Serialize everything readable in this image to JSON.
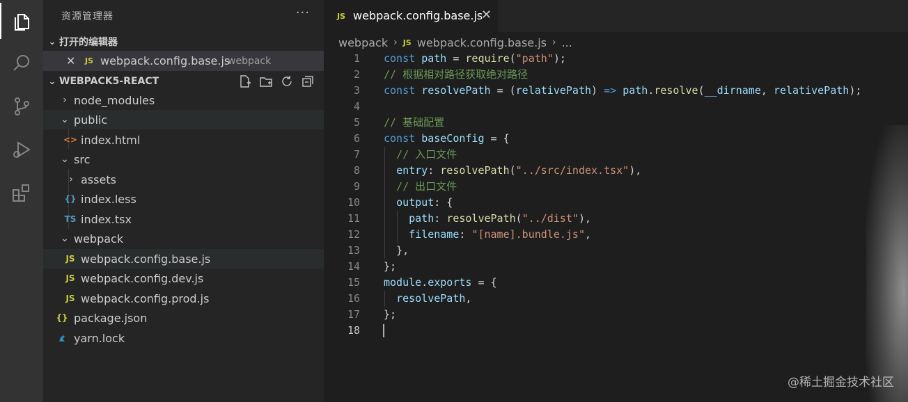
{
  "activity_bar": {
    "icons": [
      "explorer-icon",
      "search-icon",
      "source-control-icon",
      "run-debug-icon",
      "extensions-icon"
    ]
  },
  "sidebar": {
    "title": "资源管理器",
    "more": "···",
    "open_editors": {
      "header": "打开的编辑器",
      "items": [
        {
          "badge": "JS",
          "name": "webpack.config.base.js",
          "desc": "webpack"
        }
      ]
    },
    "project": {
      "header": "WEBPACK5-REACT",
      "tree": [
        {
          "label": "node_modules",
          "type": "folder",
          "expanded": false
        },
        {
          "label": "public",
          "type": "folder",
          "expanded": true
        },
        {
          "label": "index.html",
          "type": "html",
          "badge": "<>"
        },
        {
          "label": "src",
          "type": "folder",
          "expanded": true
        },
        {
          "label": "assets",
          "type": "folder",
          "expanded": false
        },
        {
          "label": "index.less",
          "type": "less",
          "badge": "{}"
        },
        {
          "label": "index.tsx",
          "type": "ts",
          "badge": "TS"
        },
        {
          "label": "webpack",
          "type": "folder",
          "expanded": true
        },
        {
          "label": "webpack.config.base.js",
          "type": "js",
          "badge": "JS"
        },
        {
          "label": "webpack.config.dev.js",
          "type": "js",
          "badge": "JS"
        },
        {
          "label": "webpack.config.prod.js",
          "type": "js",
          "badge": "JS"
        },
        {
          "label": "package.json",
          "type": "json",
          "badge": "{}"
        },
        {
          "label": "yarn.lock",
          "type": "yarn"
        }
      ]
    }
  },
  "editor": {
    "tab": {
      "badge": "JS",
      "name": "webpack.config.base.js",
      "close": "✕"
    },
    "breadcrumb": {
      "folder": "webpack",
      "file": "webpack.config.base.js",
      "tail": "..."
    },
    "line_numbers": [
      "1",
      "2",
      "3",
      "4",
      "5",
      "6",
      "7",
      "8",
      "9",
      "10",
      "11",
      "12",
      "13",
      "14",
      "15",
      "16",
      "17",
      "18"
    ],
    "current_line": "18"
  },
  "watermark": "@稀土掘金技术社区"
}
